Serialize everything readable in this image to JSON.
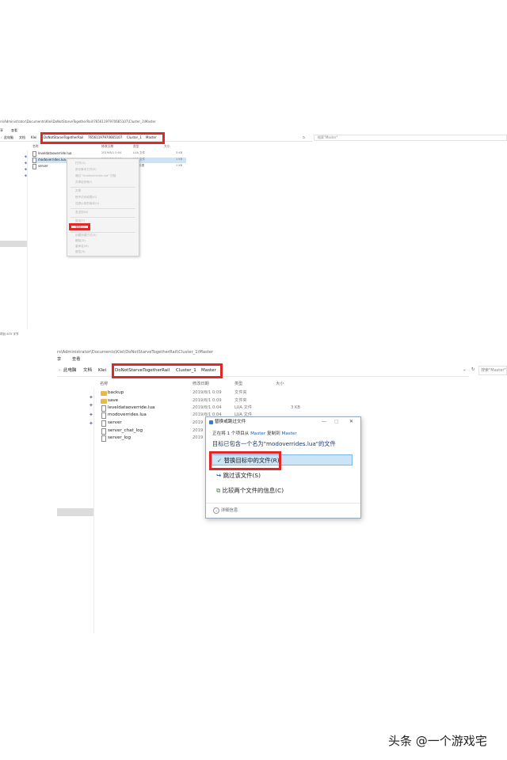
{
  "top": {
    "path_text": "rs\\Administrator\\Documents\\Klei\\DoNotStarveTogetherRail\\76561197970665107\\Cluster_1\\Master",
    "ribbon_tab1": "享",
    "ribbon_tab2": "查看",
    "crumb_pc": "此电脑",
    "crumb_docs": "文档",
    "crumb_klei": "Klei",
    "crumb_game": "DoNotStarveTogetherRail",
    "crumb_id": "76561197970665107",
    "crumb_cluster": "Cluster_1",
    "crumb_master": "Master",
    "search": "搜索\"Master\"",
    "col_name": "名称",
    "col_date": "修改日期",
    "col_type": "类型",
    "col_size": "大小",
    "files": [
      {
        "name": "leveldataoverride.lua",
        "date": "2019/8/1 0:04",
        "type": "LUA 文件",
        "size": "3 KB"
      },
      {
        "name": "modoverrides.lua",
        "date": "2019/8/1 0:04",
        "type": "LUA 文件",
        "size": "1 KB"
      },
      {
        "name": "server",
        "date": "2019/8/1 0:07",
        "type": "配置设置",
        "size": "1 KB"
      }
    ],
    "status": "项目  675 字节",
    "menu_items": [
      "打开(O)",
      "用记事本打开(E)",
      "通过 \"modoverrides.lua\" 扫描",
      "共享给其他人",
      "共享",
      "授予访问权限(G)",
      "还原以前的版本(V)",
      "发送到(N)",
      "剪切(T)",
      "复制(C)",
      "创建快捷方式(S)",
      "删除(D)",
      "重命名(M)",
      "属性(R)"
    ]
  },
  "bottom": {
    "path_text": "rs\\Administrator\\Documents\\Klei\\DoNotStarveTogetherRail\\Cluster_1\\Master",
    "ribbon_tab1": "享",
    "ribbon_tab2": "查看",
    "crumb_pc": "此电脑",
    "crumb_docs": "文档",
    "crumb_klei": "Klei",
    "crumb_game": "DoNotStarveTogetherRail",
    "crumb_cluster": "Cluster_1",
    "crumb_master": "Master",
    "search": "搜索\"Master\"",
    "col_name": "名称",
    "col_date": "修改日期",
    "col_type": "类型",
    "col_size": "大小",
    "files": [
      {
        "name": "backup",
        "date": "2019/8/1 0:09",
        "type": "文件夹",
        "size": "",
        "icon": "folder"
      },
      {
        "name": "save",
        "date": "2019/8/1 0:09",
        "type": "文件夹",
        "size": "",
        "icon": "folder"
      },
      {
        "name": "leveldataoverride.lua",
        "date": "2019/8/1 0:04",
        "type": "LUA 文件",
        "size": "3 KB",
        "icon": "file"
      },
      {
        "name": "modoverrides.lua",
        "date": "2019/8/1 0:04",
        "type": "LUA 文件",
        "size": "",
        "icon": "file"
      },
      {
        "name": "server",
        "date": "2019",
        "type": "",
        "size": "",
        "icon": "file"
      },
      {
        "name": "server_chat_log",
        "date": "2019",
        "type": "",
        "size": "",
        "icon": "file"
      },
      {
        "name": "server_log",
        "date": "2019",
        "type": "",
        "size": "",
        "icon": "file"
      }
    ],
    "dialog": {
      "title": "替换或跳过文件",
      "line1_prefix": "正在将 1 个项目从",
      "line1_src": "Master",
      "line1_mid": "复制到",
      "line1_dst": "Master",
      "line2": "目标已包含一个名为\"modoverrides.lua\"的文件",
      "opt_replace": "替换目标中的文件(R)",
      "opt_skip": "跳过该文件(S)",
      "opt_compare": "比较两个文件的信息(C)",
      "details": "详细信息",
      "min": "—",
      "max": "□",
      "close": "✕"
    }
  },
  "watermark": "头条 @一个游戏宅",
  "colors": {
    "highlight_red": "#e32626",
    "select_blue": "#cce4f7",
    "folder": "#e8b84a"
  }
}
